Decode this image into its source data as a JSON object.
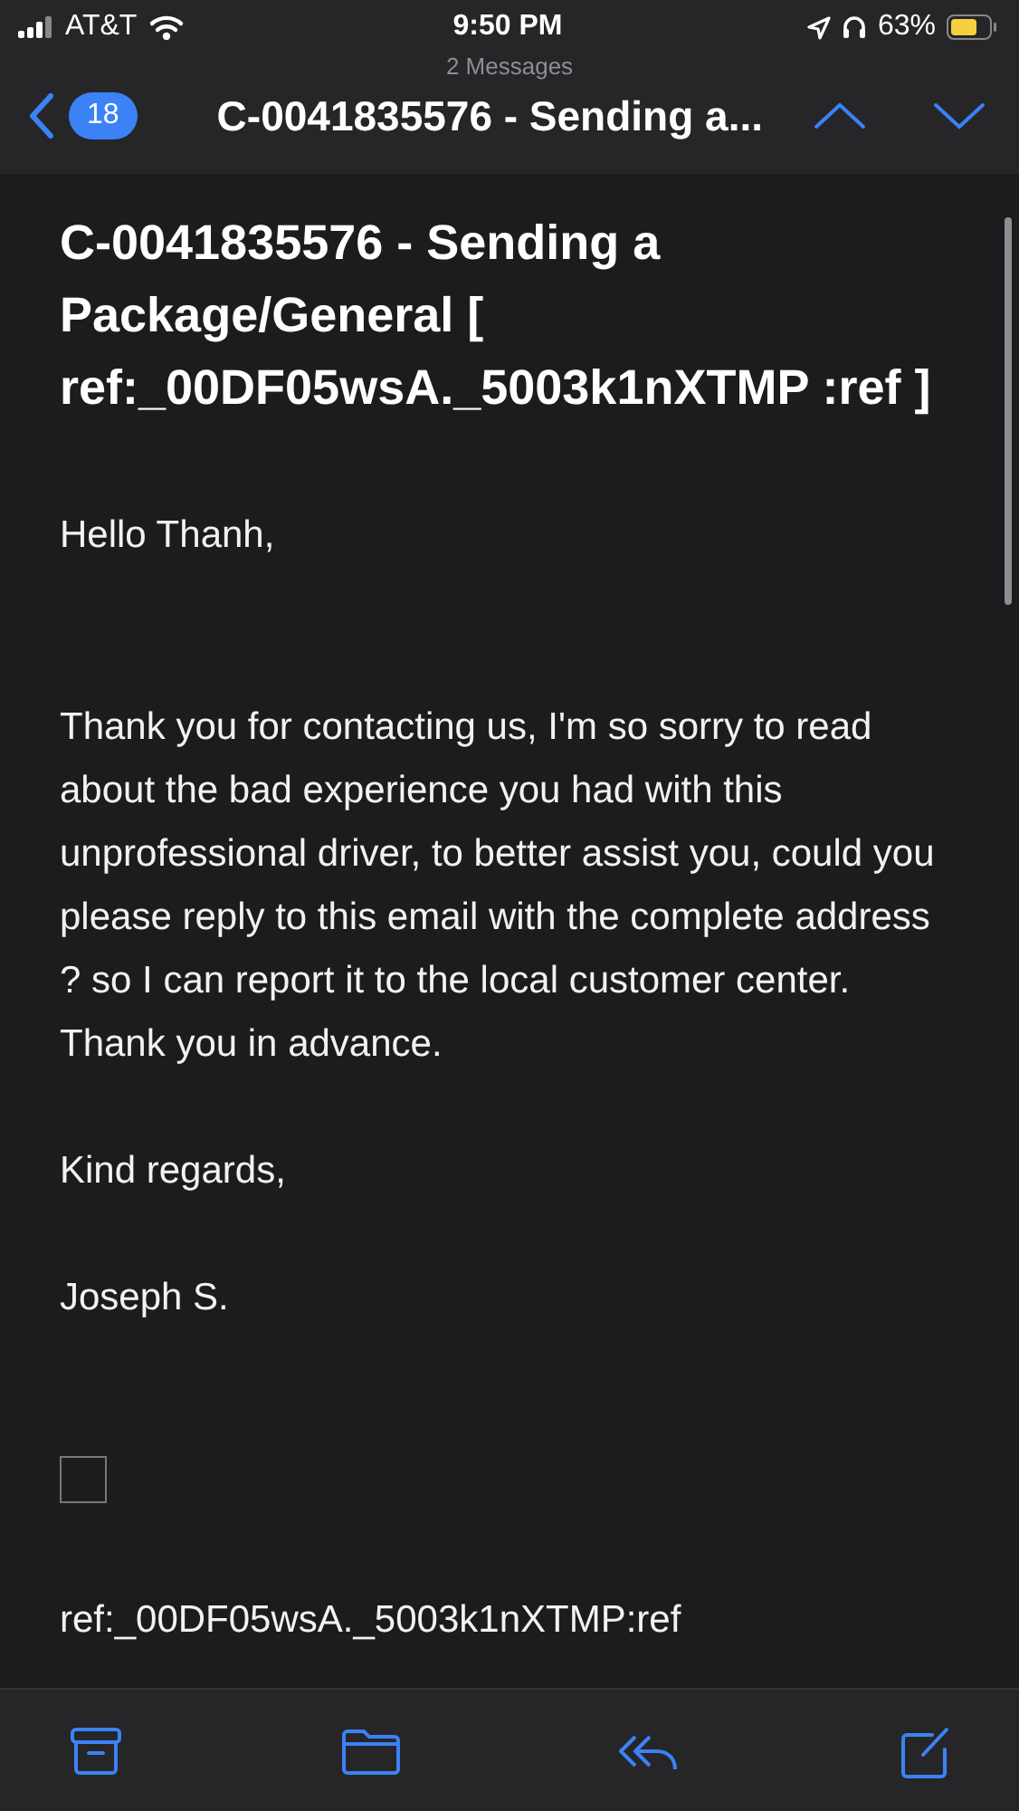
{
  "status_bar": {
    "carrier": "AT&T",
    "time": "9:50 PM",
    "battery": "63%"
  },
  "nav": {
    "count_label": "2 Messages",
    "unread_badge": "18",
    "title": "C-0041835576 - Sending a..."
  },
  "email": {
    "subject": "C-0041835576 - Sending a Package/General [ ref:_00DF05wsA._5003k1nXTMP :ref ]",
    "greeting": "Hello Thanh,",
    "body": "Thank you for contacting us, I'm so sorry to read about the bad experience you had with this unprofessional driver, to better assist you, could you please reply to this email with the complete address ? so I can report it to the local customer center. Thank you in advance.",
    "closing": "Kind regards,",
    "signature": "Joseph S.",
    "reference": "ref:_00DF05wsA._5003k1nXTMP:ref"
  },
  "toolbar": [
    {
      "kind": "archive"
    },
    {
      "kind": "folder"
    },
    {
      "kind": "reply"
    },
    {
      "kind": "compose"
    }
  ]
}
